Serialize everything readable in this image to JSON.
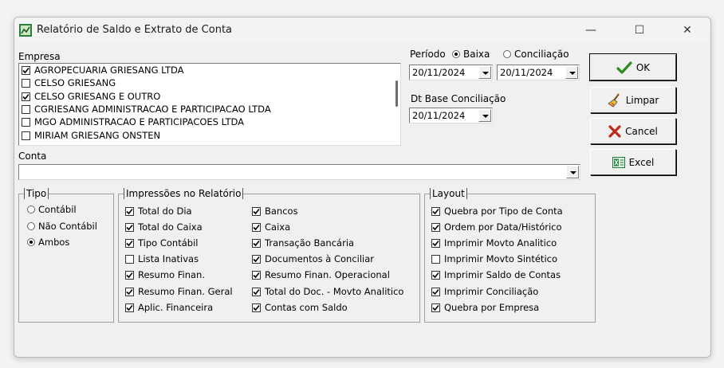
{
  "window": {
    "title": "Relatório de Saldo e Extrato de Conta",
    "controls": {
      "minimize": "—",
      "maximize": "☐",
      "close": "✕"
    }
  },
  "empresa": {
    "label": "Empresa",
    "items": [
      {
        "name": "AGROPECUARIA GRIESANG LTDA",
        "checked": true
      },
      {
        "name": "CELSO GRIESANG",
        "checked": false
      },
      {
        "name": "CELSO GRIESANG E OUTRO",
        "checked": true
      },
      {
        "name": "CGRIESANG ADMINISTRACAO E PARTICIPACAO LTDA",
        "checked": false
      },
      {
        "name": "MGO ADMINISTRACAO E PARTICIPACOES LTDA",
        "checked": false
      },
      {
        "name": "MIRIAM GRIESANG ONSTEN",
        "checked": false
      }
    ]
  },
  "periodo": {
    "label": "Período",
    "radio_baixa": "Baixa",
    "radio_conciliacao": "Conciliação",
    "selected": "Baixa",
    "date_start": "20/11/2024",
    "date_end": "20/11/2024"
  },
  "dt_base": {
    "label": "Dt Base Conciliação",
    "date": "20/11/2024"
  },
  "conta": {
    "label": "Conta",
    "value": ""
  },
  "tipo": {
    "title": "Tipo",
    "options": [
      {
        "label": "Contábil",
        "selected": false
      },
      {
        "label": "Não Contábil",
        "selected": false
      },
      {
        "label": "Ambos",
        "selected": true
      }
    ]
  },
  "impressoes": {
    "title": "Impressões no Relatório",
    "col1": [
      {
        "label": "Total do Dia",
        "checked": true
      },
      {
        "label": "Total do Caixa",
        "checked": true
      },
      {
        "label": "Tipo Contábil",
        "checked": true
      },
      {
        "label": "Lista Inativas",
        "checked": false
      },
      {
        "label": "Resumo Finan.",
        "checked": true
      },
      {
        "label": "Resumo Finan. Geral",
        "checked": true
      },
      {
        "label": "Aplic. Financeira",
        "checked": true
      }
    ],
    "col2": [
      {
        "label": "Bancos",
        "checked": true
      },
      {
        "label": "Caixa",
        "checked": true
      },
      {
        "label": "Transação Bancária",
        "checked": true
      },
      {
        "label": "Documentos à Conciliar",
        "checked": true
      },
      {
        "label": "Resumo Finan. Operacional",
        "checked": true
      },
      {
        "label": "Total do Doc. - Movto Analitico",
        "checked": true
      },
      {
        "label": "Contas com Saldo",
        "checked": true
      }
    ]
  },
  "layout": {
    "title": "Layout",
    "items": [
      {
        "label": "Quebra por Tipo de Conta",
        "checked": true
      },
      {
        "label": "Ordem por Data/Histórico",
        "checked": true
      },
      {
        "label": "Imprimir Movto Analitico",
        "checked": true
      },
      {
        "label": "Imprimir Movto Sintético",
        "checked": false
      },
      {
        "label": "Imprimir Saldo de Contas",
        "checked": true
      },
      {
        "label": "Imprimir Conciliação",
        "checked": true
      },
      {
        "label": "Quebra por Empresa",
        "checked": true
      }
    ]
  },
  "buttons": {
    "ok": "OK",
    "limpar": "Limpar",
    "cancel": "Cancel",
    "excel": "Excel"
  },
  "colors": {
    "ok_green": "#2e8b1f",
    "cancel_red": "#c0281c",
    "excel_green": "#1d7a3a"
  }
}
